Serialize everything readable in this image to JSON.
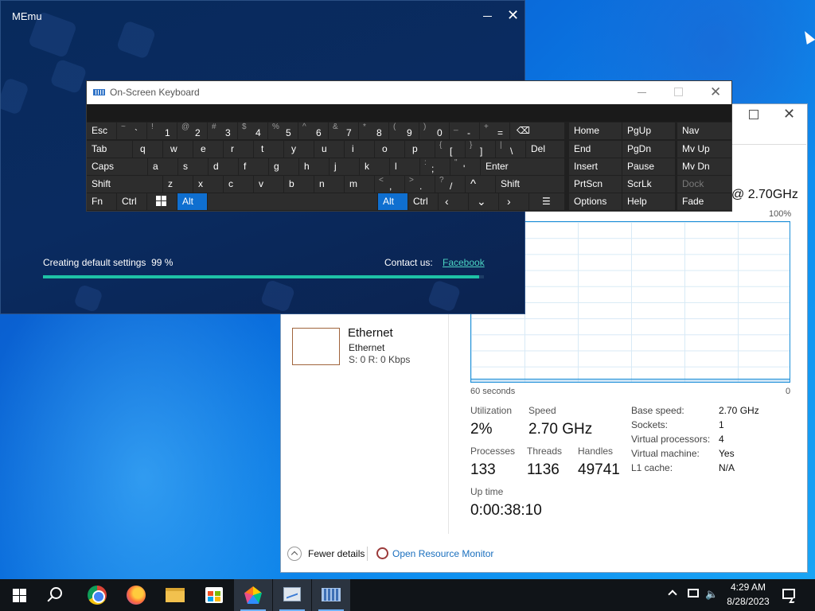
{
  "memu": {
    "title": "MEmu",
    "status_text": "Creating default settings  99 %",
    "progress": 0.99,
    "contact_label": "Contact us:",
    "facebook_link": "Facebook",
    "minimize_icon": "minimize-icon",
    "close_icon": "close-icon"
  },
  "osk": {
    "title": "On-Screen Keyboard",
    "row1": [
      {
        "label": "Esc"
      },
      {
        "shift": "~",
        "main": "`"
      },
      {
        "shift": "!",
        "main": "1"
      },
      {
        "shift": "@",
        "main": "2"
      },
      {
        "shift": "#",
        "main": "3"
      },
      {
        "shift": "$",
        "main": "4"
      },
      {
        "shift": "%",
        "main": "5"
      },
      {
        "shift": "^",
        "main": "6"
      },
      {
        "shift": "&",
        "main": "7"
      },
      {
        "shift": "*",
        "main": "8"
      },
      {
        "shift": "(",
        "main": "9"
      },
      {
        "shift": ")",
        "main": "0"
      },
      {
        "shift": "_",
        "main": "-"
      },
      {
        "shift": "+",
        "main": "="
      },
      {
        "label": "⌫"
      }
    ],
    "row2": [
      "Tab",
      "q",
      "w",
      "e",
      "r",
      "t",
      "y",
      "u",
      "i",
      "o",
      "p",
      "[",
      "]",
      "\\",
      "Del"
    ],
    "row2_brace_shift": [
      "{",
      "}",
      "|"
    ],
    "row3": [
      "Caps",
      "a",
      "s",
      "d",
      "f",
      "g",
      "h",
      "j",
      "k",
      "l",
      ";",
      "'",
      "Enter"
    ],
    "row3_shift": [
      ":",
      "\""
    ],
    "row4": [
      "Shift",
      "z",
      "x",
      "c",
      "v",
      "b",
      "n",
      "m",
      ",",
      ".",
      "/",
      "^",
      "Shift"
    ],
    "row4_shift": [
      "<",
      ">",
      "?"
    ],
    "row5": [
      "Fn",
      "Ctrl",
      "Alt",
      "Alt",
      "Ctrl"
    ],
    "nav_keys": [
      [
        "Home",
        "PgUp",
        "Nav"
      ],
      [
        "End",
        "PgDn",
        "Mv Up"
      ],
      [
        "Insert",
        "Pause",
        "Mv Dn"
      ],
      [
        "PrtScn",
        "ScrLk",
        "Dock"
      ],
      [
        "Options",
        "Help",
        "Fade"
      ]
    ]
  },
  "taskmgr": {
    "cpu_name": "@ 2.70GHz",
    "graph_top_label": "100%",
    "axis_left": "60 seconds",
    "axis_right": "0",
    "ethernet": {
      "title": "Ethernet",
      "subtitle": "Ethernet",
      "rate": "S: 0 R: 0 Kbps"
    },
    "stats": {
      "utilization_label": "Utilization",
      "utilization": "2%",
      "speed_label": "Speed",
      "speed": "2.70 GHz",
      "processes_label": "Processes",
      "processes": "133",
      "threads_label": "Threads",
      "threads": "1136",
      "handles_label": "Handles",
      "handles": "49741",
      "uptime_label": "Up time",
      "uptime": "0:00:38:10"
    },
    "specs": [
      {
        "label": "Base speed:",
        "value": "2.70 GHz"
      },
      {
        "label": "Sockets:",
        "value": "1"
      },
      {
        "label": "Virtual processors:",
        "value": "4"
      },
      {
        "label": "Virtual machine:",
        "value": "Yes"
      },
      {
        "label": "L1 cache:",
        "value": "N/A"
      }
    ],
    "fewer_details": "Fewer details",
    "open_resource_monitor": "Open Resource Monitor"
  },
  "taskbar": {
    "items": [
      "start-icon",
      "search-icon",
      "chrome-icon",
      "firefox-icon",
      "file-explorer-icon",
      "store-icon",
      "memu-icon",
      "task-manager-icon",
      "on-screen-keyboard-icon"
    ],
    "time": "4:29 AM",
    "date": "8/28/2023"
  }
}
